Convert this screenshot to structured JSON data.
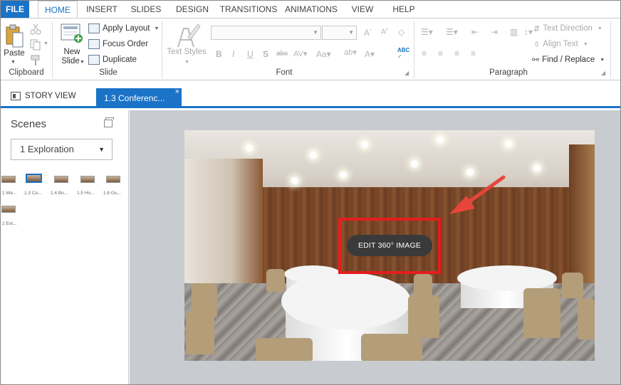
{
  "ribbon_tabs": [
    "FILE",
    "HOME",
    "INSERT",
    "SLIDES",
    "DESIGN",
    "TRANSITIONS",
    "ANIMATIONS",
    "VIEW",
    "HELP"
  ],
  "active_tab": "HOME",
  "clipboard": {
    "paste_label": "Paste",
    "group_label": "Clipboard"
  },
  "slide": {
    "new_slide_line1": "New",
    "new_slide_line2": "Slide",
    "apply_layout": "Apply Layout",
    "focus_order": "Focus Order",
    "duplicate": "Duplicate",
    "group_label": "Slide"
  },
  "text_styles": {
    "label": "Text Styles"
  },
  "font": {
    "group_label": "Font"
  },
  "paragraph": {
    "text_direction": "Text Direction",
    "align_text": "Align Text",
    "find_replace": "Find / Replace",
    "group_label": "Paragraph"
  },
  "doc_tabs": {
    "story_view": "STORY VIEW",
    "active_doc": "1.3 Conferenc...",
    "close_glyph": "×"
  },
  "scenes_panel": {
    "title": "Scenes",
    "selected_scene": "1 Exploration",
    "thumbnails": [
      {
        "label": "1 We..."
      },
      {
        "label": "1.3 Co...",
        "selected": true
      },
      {
        "label": "1.4 Bo..."
      },
      {
        "label": "1.5 Ho..."
      },
      {
        "label": "1.6 Gu..."
      },
      {
        "label": "2 Ent..."
      }
    ]
  },
  "canvas": {
    "edit_button": "EDIT 360° IMAGE"
  },
  "colors": {
    "accent": "#1a73c6",
    "highlight": "#e51d1d",
    "arrow": "#e8453a"
  }
}
